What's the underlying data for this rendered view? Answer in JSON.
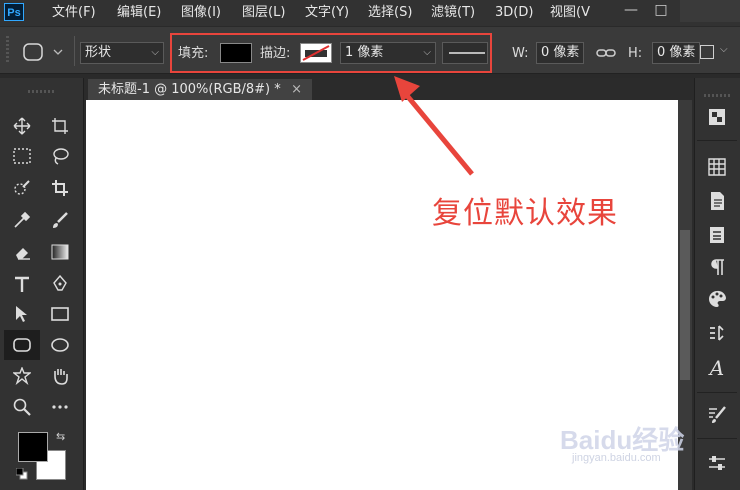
{
  "app": {
    "logo": "Ps"
  },
  "menu": [
    "文件(F)",
    "编辑(E)",
    "图像(I)",
    "图层(L)",
    "文字(Y)",
    "选择(S)",
    "滤镜(T)",
    "3D(D)",
    "视图(V"
  ],
  "window_controls": {
    "minimize": "—",
    "restore": "□"
  },
  "options": {
    "mode": "形状",
    "fill_label": "填充:",
    "fill_color": "#000000",
    "stroke_label": "描边:",
    "stroke_width": "1 像素",
    "w_label": "W:",
    "w_value": "0 像素",
    "h_label": "H:",
    "h_value": "0 像素"
  },
  "document": {
    "tab_title": "未标题-1 @ 100%(RGB/8#) *",
    "close": "×"
  },
  "annotation": {
    "text": "复位默认效果",
    "color": "#e8453c"
  },
  "colors": {
    "foreground": "#000000",
    "background": "#ffffff"
  },
  "watermark": {
    "brand": "Baidu经验",
    "url": "jingyan.baidu.com"
  }
}
